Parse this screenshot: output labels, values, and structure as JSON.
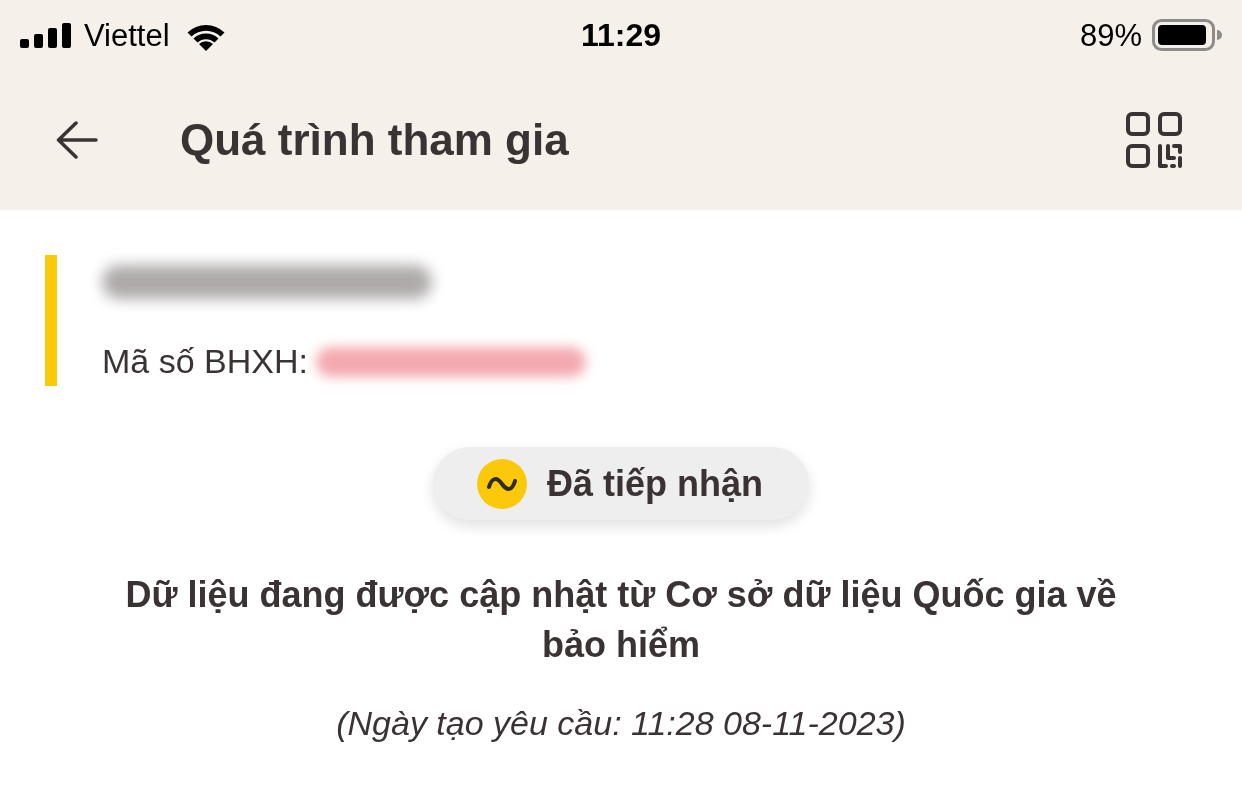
{
  "status_bar": {
    "carrier": "Viettel",
    "time": "11:29",
    "battery": "89%"
  },
  "header": {
    "title": "Quá trình tham gia"
  },
  "profile": {
    "id_label": "Mã số BHXH:"
  },
  "status_badge": {
    "label": "Đã tiếp nhận"
  },
  "message": "Dữ liệu đang được cập nhật từ Cơ sở dữ liệu Quốc gia về bảo hiểm",
  "request_date": "(Ngày tạo yêu cầu: 11:28 08-11-2023)"
}
